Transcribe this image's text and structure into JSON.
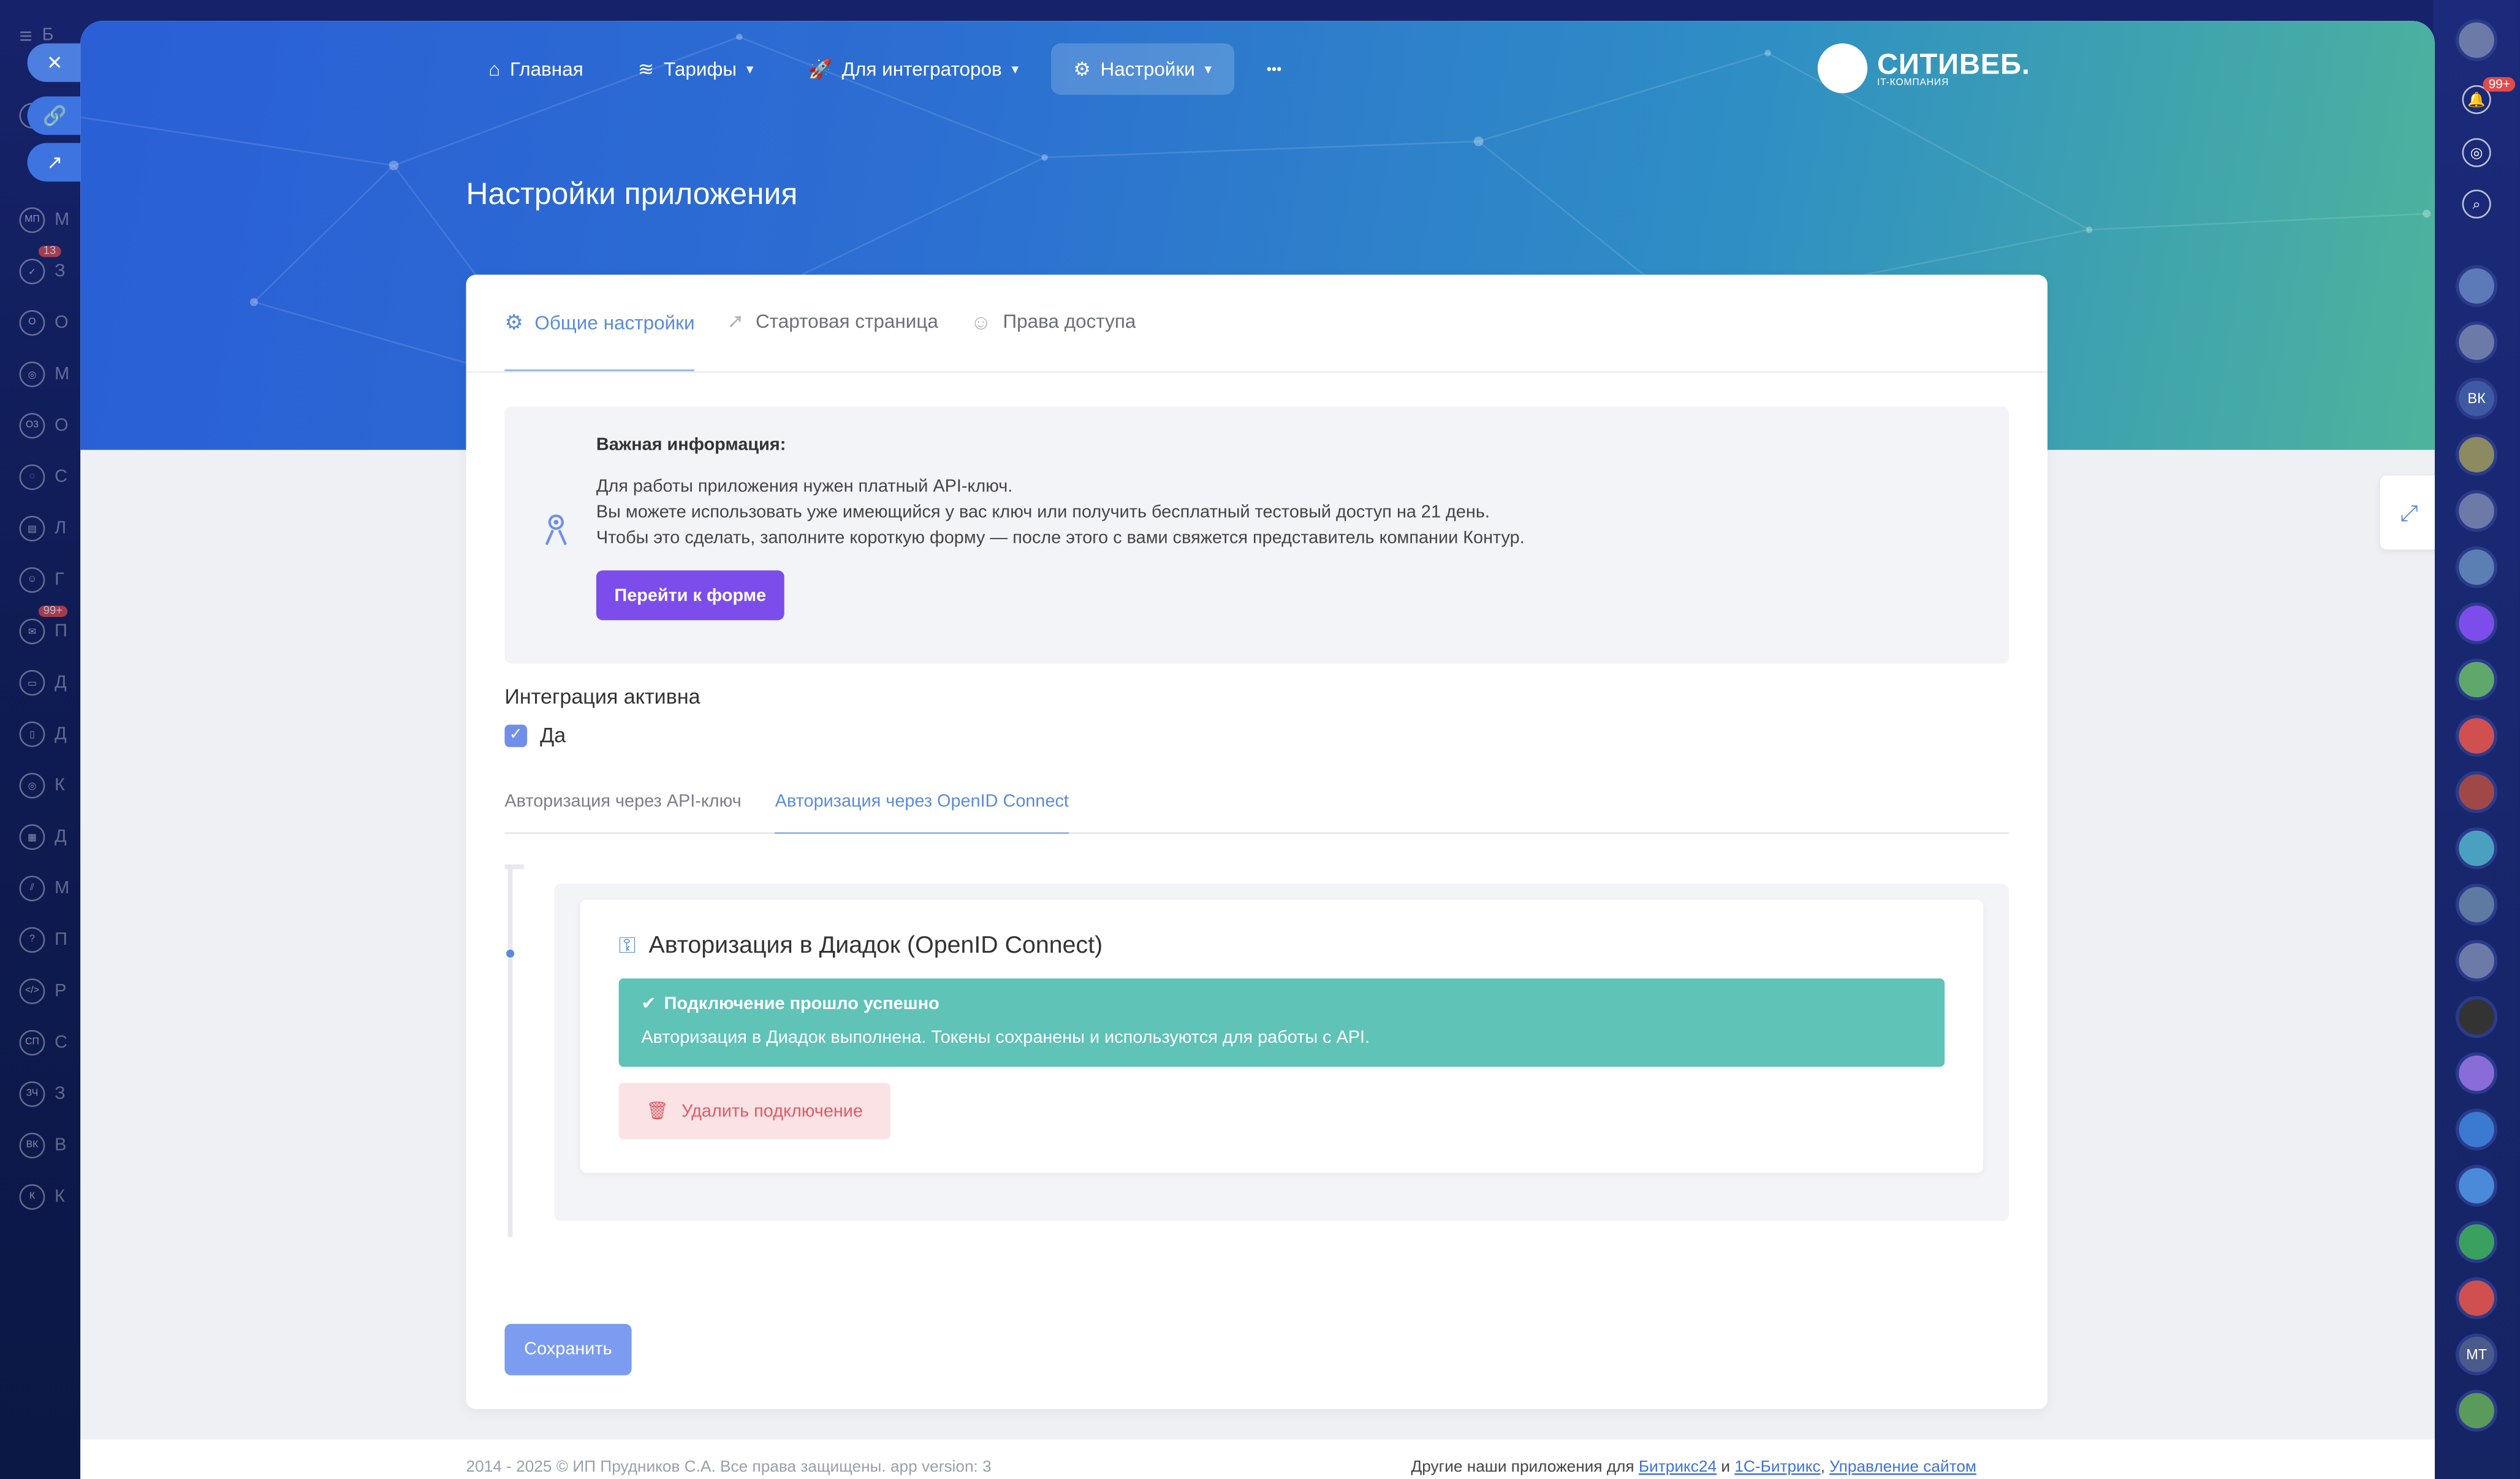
{
  "nav": {
    "home": "Главная",
    "tariffs": "Тарифы",
    "integrators": "Для интеграторов",
    "settings": "Настройки",
    "more": "•••"
  },
  "logo": {
    "name": "СИТИВЕБ.",
    "tagline": "IT-КОМПАНИЯ"
  },
  "page_title": "Настройки приложения",
  "tabs": [
    {
      "label": "Общие настройки",
      "icon": "gear-icon"
    },
    {
      "label": "Стартовая страница",
      "icon": "rocket-icon"
    },
    {
      "label": "Права доступа",
      "icon": "user-icon"
    }
  ],
  "info": {
    "title": "Важная информация:",
    "line1": "Для работы приложения нужен платный API-ключ.",
    "line2": "Вы можете использовать уже имеющийся у вас ключ или получить бесплатный тестовый доступ на 21 день.",
    "line3": "Чтобы это сделать, заполните короткую форму — после этого с вами свяжется представитель компании Контур.",
    "button": "Перейти к форме"
  },
  "integration": {
    "label": "Интеграция активна",
    "checkbox_label": "Да",
    "checked": true
  },
  "subtabs": [
    "Авторизация через API-ключ",
    "Авторизация через OpenID Connect"
  ],
  "auth": {
    "title": "Авторизация в Диадок (OpenID Connect)",
    "success_title": "Подключение прошло успешно",
    "success_text": "Авторизация в Диадок выполнена. Токены сохранены и используются для работы с API.",
    "delete_button": "Удалить подключение"
  },
  "save_button": "Сохранить",
  "footer": {
    "left": "2014 - 2025 © ИП Прудников С.А. Все права защищены. app version: 3",
    "right_prefix": "Другие наши приложения для ",
    "link1": "Битрикс24",
    "and": " и ",
    "link2": "1С-Битрикс",
    "link3": "Управление сайтом"
  },
  "sidebar": {
    "badges": [
      "13",
      "99+"
    ],
    "right_badge": "99+",
    "right_initials": [
      "ВК",
      "МТ"
    ]
  },
  "colors": {
    "accent": "#5b8bd8",
    "purple_button": "#7c4dea",
    "success": "#5fc3b8",
    "danger_bg": "#fbe2e4",
    "danger_text": "#e05b66",
    "save": "#7b9cf0"
  }
}
